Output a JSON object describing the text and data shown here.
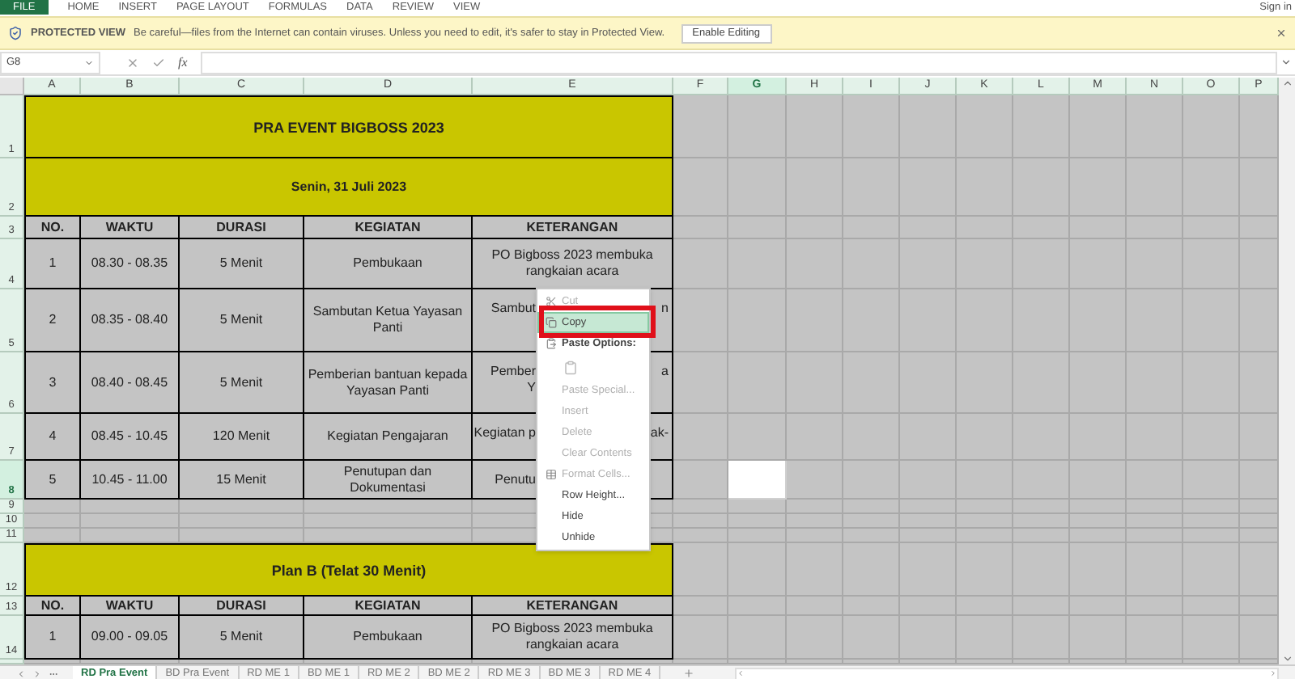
{
  "ribbon_tabs": [
    {
      "label": "FILE",
      "selected": true
    },
    {
      "label": "HOME",
      "selected": false
    },
    {
      "label": "INSERT",
      "selected": false
    },
    {
      "label": "PAGE LAYOUT",
      "selected": false
    },
    {
      "label": "FORMULAS",
      "selected": false
    },
    {
      "label": "DATA",
      "selected": false
    },
    {
      "label": "REVIEW",
      "selected": false
    },
    {
      "label": "VIEW",
      "selected": false
    }
  ],
  "account": "Sign in",
  "protected_view": {
    "title": "PROTECTED VIEW",
    "message": "Be careful—files from the Internet can contain viruses. Unless you need to edit, it's safer to stay in Protected View.",
    "button": "Enable Editing"
  },
  "formula_bar": {
    "name_box": "G8",
    "function_label": "fx"
  },
  "columns": [
    {
      "label": "A",
      "selected": false
    },
    {
      "label": "B",
      "selected": false
    },
    {
      "label": "C",
      "selected": false
    },
    {
      "label": "D",
      "selected": false
    },
    {
      "label": "E",
      "selected": false
    },
    {
      "label": "F",
      "selected": false
    },
    {
      "label": "G",
      "selected": true
    },
    {
      "label": "H",
      "selected": false
    },
    {
      "label": "I",
      "selected": false
    },
    {
      "label": "J",
      "selected": false
    },
    {
      "label": "K",
      "selected": false
    },
    {
      "label": "L",
      "selected": false
    },
    {
      "label": "M",
      "selected": false
    },
    {
      "label": "N",
      "selected": false
    },
    {
      "label": "O",
      "selected": false
    },
    {
      "label": "P",
      "selected": false
    }
  ],
  "rows": [
    {
      "label": "1",
      "selected": false
    },
    {
      "label": "2",
      "selected": false
    },
    {
      "label": "3",
      "selected": false
    },
    {
      "label": "4",
      "selected": false
    },
    {
      "label": "5",
      "selected": false
    },
    {
      "label": "6",
      "selected": false
    },
    {
      "label": "7",
      "selected": false
    },
    {
      "label": "8",
      "selected": true
    },
    {
      "label": "9",
      "selected": false
    },
    {
      "label": "10",
      "selected": false
    },
    {
      "label": "11",
      "selected": false
    },
    {
      "label": "12",
      "selected": false
    },
    {
      "label": "13",
      "selected": false
    },
    {
      "label": "14",
      "selected": false
    }
  ],
  "schedule": {
    "title": "PRA EVENT BIGBOSS 2023",
    "date": "Senin, 31 Juli 2023",
    "header": [
      "NO.",
      "WAKTU",
      "DURASI",
      "KEGIATAN",
      "KETERANGAN"
    ],
    "rows": [
      {
        "cells": [
          "1",
          "08.30 - 08.35",
          "5 Menit",
          "Pembukaan"
        ],
        "keterangan": {
          "kind": "full",
          "text": "PO Bigboss 2023 membuka rangkaian acara"
        }
      },
      {
        "cells": [
          "2",
          "08.35 - 08.40",
          "5 Menit",
          "Sambutan Ketua Yayasan Panti"
        ],
        "keterangan": {
          "kind": "partial",
          "left": [
            "Sambut"
          ],
          "right": [
            "n"
          ]
        }
      },
      {
        "cells": [
          "3",
          "08.40 - 08.45",
          "5 Menit",
          "Pemberian bantuan kepada Yayasan Panti"
        ],
        "keterangan": {
          "kind": "partial",
          "left": [
            "Pember",
            "Y"
          ],
          "right": [
            "a"
          ]
        }
      },
      {
        "cells": [
          "4",
          "08.45 - 10.45",
          "120 Menit",
          "Kegiatan Pengajaran"
        ],
        "keterangan": {
          "kind": "partial",
          "left": [
            "Kegiatan p"
          ],
          "right": [
            "ak-"
          ]
        }
      },
      {
        "cells": [
          "5",
          "10.45 - 11.00",
          "15 Menit",
          "Penutupan dan Dokumentasi"
        ],
        "keterangan": {
          "kind": "partial",
          "left": [
            "Penutu"
          ]
        }
      }
    ]
  },
  "plan_b": {
    "title": "Plan B (Telat 30 Menit)",
    "header": [
      "NO.",
      "WAKTU",
      "DURASI",
      "KEGIATAN",
      "KETERANGAN"
    ],
    "rows": [
      {
        "cells": [
          "1",
          "09.00 - 09.05",
          "5 Menit",
          "Pembukaan"
        ],
        "keterangan": {
          "kind": "full",
          "text": "PO Bigboss 2023 membuka rangkaian acara"
        }
      }
    ]
  },
  "context_menu": {
    "items": [
      {
        "kind": "cut",
        "label": "Cut",
        "disabled": true,
        "selected": false
      },
      {
        "kind": "copy",
        "label": "Copy",
        "disabled": false,
        "selected": true
      },
      {
        "kind": "paste-header",
        "label": "Paste Options:",
        "disabled": false,
        "selected": false
      },
      {
        "kind": "paste-icon",
        "disabled": true,
        "selected": false
      },
      {
        "kind": "plain",
        "label": "Paste Special...",
        "disabled": true,
        "selected": false
      },
      {
        "kind": "plain",
        "label": "Insert",
        "disabled": true,
        "selected": false
      },
      {
        "kind": "plain",
        "label": "Delete",
        "disabled": true,
        "selected": false
      },
      {
        "kind": "plain",
        "label": "Clear Contents",
        "disabled": true,
        "selected": false
      },
      {
        "kind": "format",
        "label": "Format Cells...",
        "disabled": true,
        "selected": false
      },
      {
        "kind": "plain",
        "label": "Row Height...",
        "disabled": false,
        "selected": false
      },
      {
        "kind": "plain",
        "label": "Hide",
        "disabled": false,
        "selected": false
      },
      {
        "kind": "plain",
        "label": "Unhide",
        "disabled": false,
        "selected": false
      }
    ]
  },
  "sheet_tabs": [
    {
      "label": "RD Pra Event",
      "selected": true
    },
    {
      "label": "BD Pra Event",
      "selected": false
    },
    {
      "label": "RD ME 1",
      "selected": false
    },
    {
      "label": "BD ME 1",
      "selected": false
    },
    {
      "label": "RD ME 2",
      "selected": false
    },
    {
      "label": "BD ME 2",
      "selected": false
    },
    {
      "label": "RD ME 3",
      "selected": false
    },
    {
      "label": "BD ME 3",
      "selected": false
    },
    {
      "label": "RD ME 4",
      "selected": false
    }
  ]
}
